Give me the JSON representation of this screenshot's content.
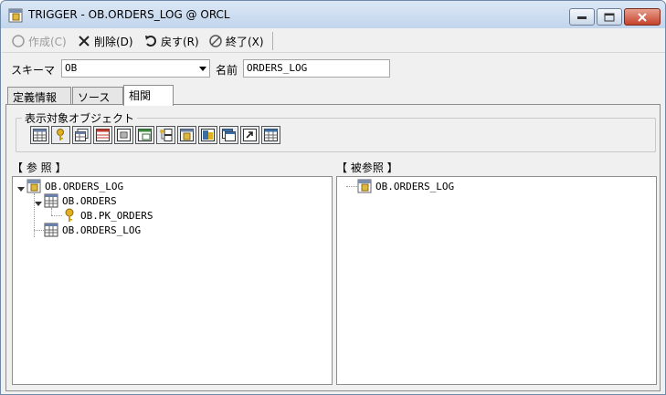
{
  "window": {
    "title": "TRIGGER - OB.ORDERS_LOG @ ORCL"
  },
  "toolbar": {
    "create_label": "作成(C)",
    "delete_label": "削除(D)",
    "back_label": "戻す(R)",
    "exit_label": "終了(X)"
  },
  "form": {
    "schema_label": "スキーマ",
    "schema_value": "OB",
    "name_label": "名前",
    "name_value": "ORDERS_LOG"
  },
  "tabs": [
    {
      "label": "定義情報"
    },
    {
      "label": "ソース"
    },
    {
      "label": "相関"
    }
  ],
  "display_objects": {
    "group_label": "表示対象オブジェクト",
    "buttons": [
      "table-icon",
      "key-icon",
      "index-icon",
      "constraint-icon",
      "sequence-icon",
      "view-icon",
      "relation-icon",
      "trigger-icon",
      "package-icon",
      "synonym-icon",
      "shortcut-icon",
      "grid-icon"
    ]
  },
  "references": {
    "label": "【 参 照 】",
    "root": "OB.ORDERS_LOG",
    "child_table": "OB.ORDERS",
    "child_key": "OB.PK_ORDERS",
    "child_log": "OB.ORDERS_LOG"
  },
  "referenced_by": {
    "label": "【 被参照 】",
    "root": "OB.ORDERS_LOG"
  },
  "colors": {
    "titlebar": "#c2d5ec",
    "close_button": "#c6412a",
    "window_bg": "#f0f0f0"
  }
}
